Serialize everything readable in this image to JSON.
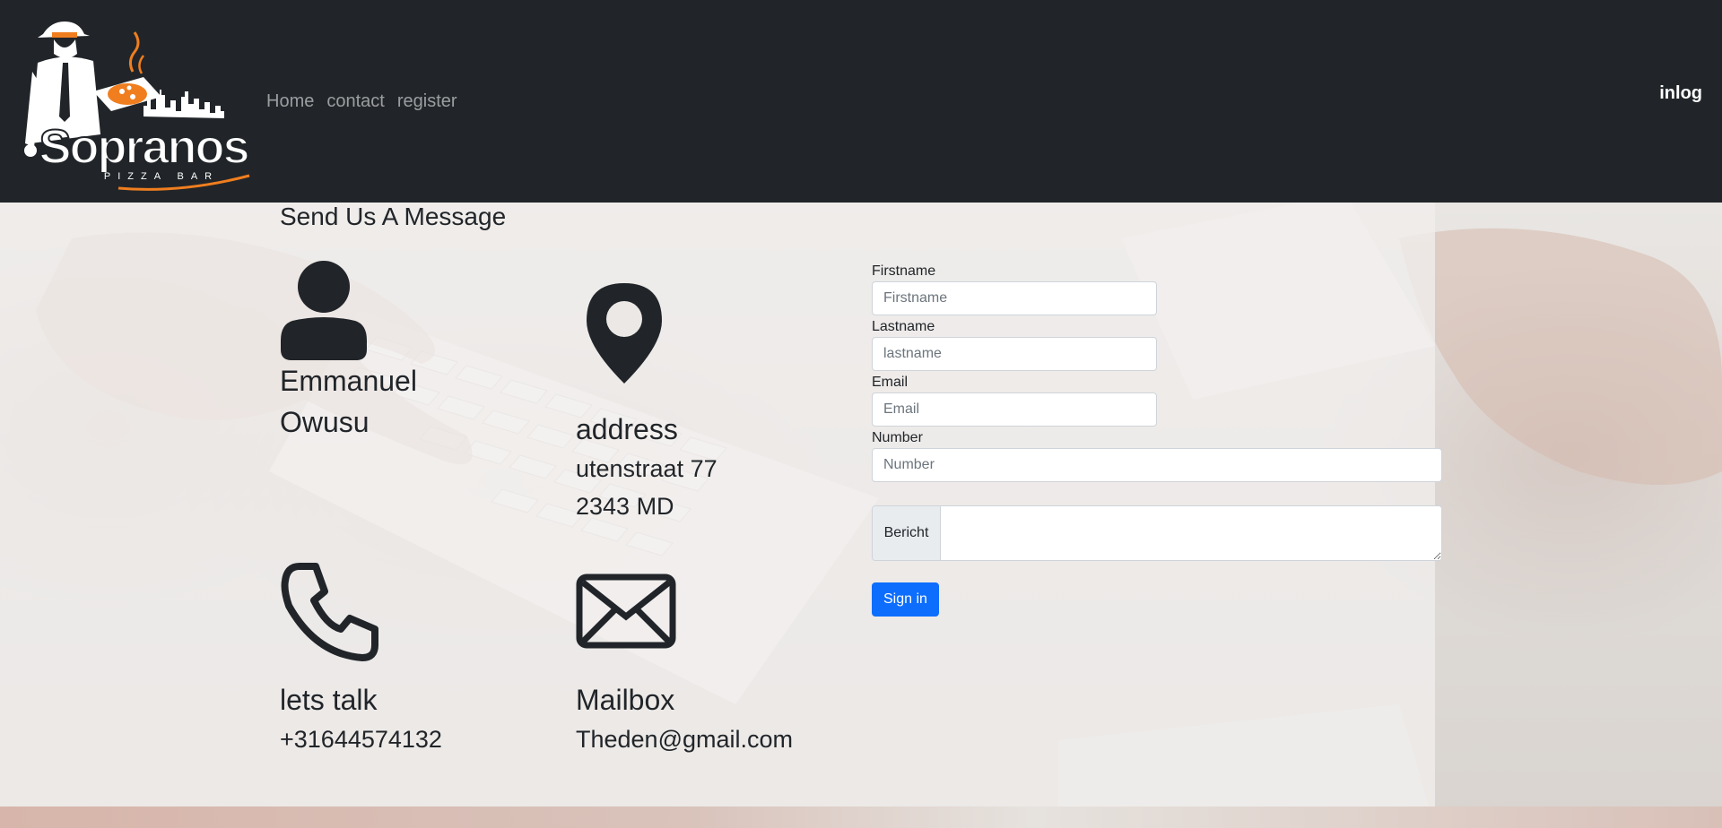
{
  "navbar": {
    "brand": {
      "name": "Sopranos",
      "tagline": "PIZZA BAR"
    },
    "links": [
      "Home",
      "contact",
      "register"
    ],
    "login_label": "inlog"
  },
  "page": {
    "title": "Send Us A Message"
  },
  "contact": {
    "person": {
      "icon": "person-icon",
      "first": "Emmanuel",
      "last": "Owusu"
    },
    "address": {
      "icon": "map-pin-icon",
      "title": "address",
      "street": "utenstraat 77",
      "postcode": "2343 MD"
    },
    "phone": {
      "icon": "phone-icon",
      "title": "lets talk",
      "number": "+31644574132"
    },
    "mail": {
      "icon": "envelope-icon",
      "title": "Mailbox",
      "address": "Theden@gmail.com"
    }
  },
  "form": {
    "firstname": {
      "label": "Firstname",
      "placeholder": "Firstname"
    },
    "lastname": {
      "label": "Lastname",
      "placeholder": "lastname"
    },
    "email": {
      "label": "Email",
      "placeholder": "Email"
    },
    "number": {
      "label": "Number",
      "placeholder": "Number"
    },
    "message_addon": "Bericht",
    "submit_label": "Sign in"
  },
  "colors": {
    "navbar": "#212529",
    "primary": "#0d6efd",
    "brand_orange": "#f07e1f"
  }
}
